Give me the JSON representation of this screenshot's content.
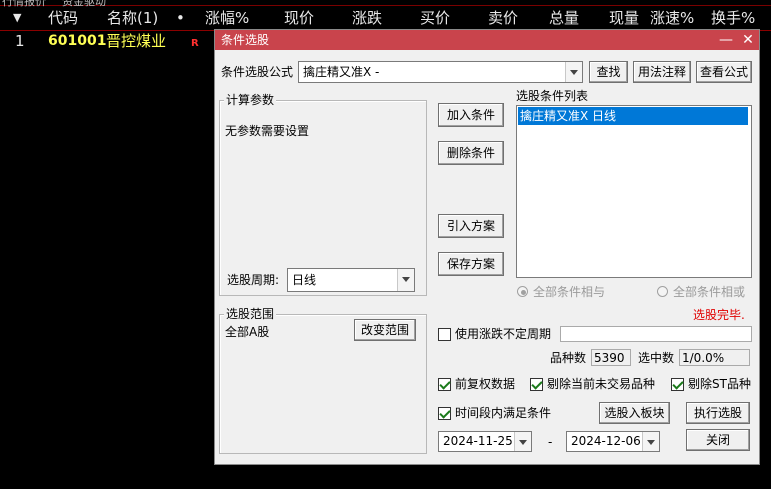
{
  "stock_list": {
    "top_tabs": [
      "行情报价",
      "资金驱动"
    ],
    "headers": [
      "代码",
      "名称(1)",
      "•",
      "涨幅%",
      "现价",
      "涨跌",
      "买价",
      "卖价",
      "总量",
      "现量",
      "涨速%",
      "换手%"
    ],
    "row": {
      "index": "1",
      "code": "601001",
      "name": "晋控煤业",
      "flag": "R"
    }
  },
  "dialog": {
    "title": "条件选股",
    "formula_label": "条件选股公式",
    "formula_value": "擒庄精又准X  -",
    "find_button": "查找",
    "usage_button": "用法注释",
    "view_formula_button": "查看公式",
    "params_group": "计算参数",
    "params_text": "无参数需要设置",
    "period_label": "选股周期:",
    "period_value": "日线",
    "add_condition": "加入条件",
    "delete_condition": "删除条件",
    "import_plan": "引入方案",
    "save_plan": "保存方案",
    "condition_list_label": "选股条件列表",
    "condition_items": [
      "擒庄精又准X  日线"
    ],
    "radio_and": "全部条件相与",
    "radio_or": "全部条件相或",
    "status": "选股完毕.",
    "range_group": "选股范围",
    "range_value": "全部A股",
    "change_range": "改变范围",
    "uncertain_period": "使用涨跌不定周期",
    "count_label": "品种数",
    "count_value": "5390",
    "selected_label": "选中数",
    "selected_value": "1/0.0%",
    "pre_adjust": "前复权数据",
    "exclude_untraded": "剔除当前未交易品种",
    "exclude_st": "剔除ST品种",
    "time_condition": "时间段内满足条件",
    "to_block": "选股入板块",
    "execute": "执行选股",
    "date_from": "2024-11-25",
    "date_sep": "-",
    "date_to": "2024-12-06",
    "close": "关闭"
  },
  "colors": {
    "title_bar": "#c9444c",
    "code_yellow": "#ffff54",
    "status_red": "#e00000",
    "selection": "#0078d7"
  }
}
